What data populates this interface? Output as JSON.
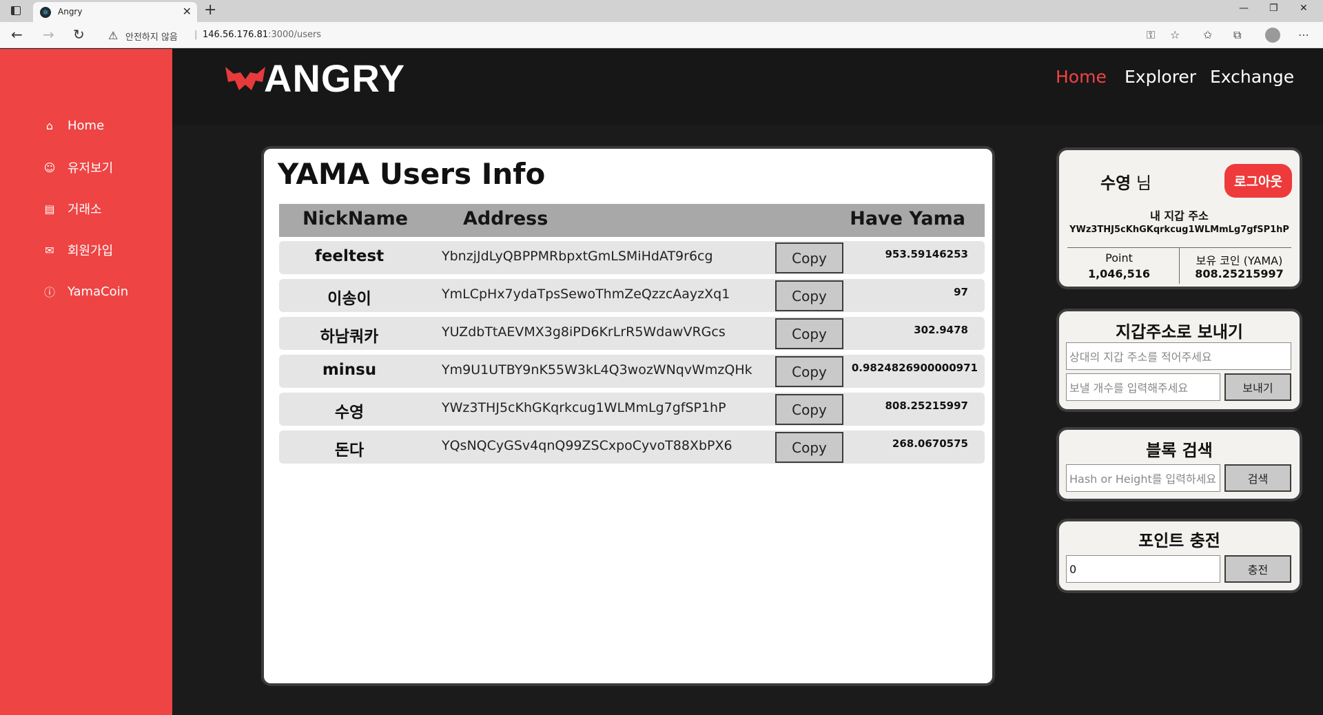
{
  "browser": {
    "tab_title": "Angry",
    "tab_close": "✕",
    "new_tab": "+",
    "security_label": "안전하지 않음",
    "url_host": "146.56.176.81",
    "url_path": ":3000/users",
    "minimize": "—",
    "maximize": "❐",
    "close": "✕"
  },
  "sidebar": {
    "items": [
      {
        "icon": "home-icon",
        "label": "Home"
      },
      {
        "icon": "user-icon",
        "label": "유저보기"
      },
      {
        "icon": "database-icon",
        "label": "거래소"
      },
      {
        "icon": "mail-icon",
        "label": "회원가입"
      },
      {
        "icon": "info-icon",
        "label": "YamaCoin"
      }
    ]
  },
  "header": {
    "logo_text": "ANGRY",
    "nav": [
      "Home",
      "Explorer",
      "Exchange"
    ],
    "active_nav": "Home"
  },
  "users_panel": {
    "title": "YAMA Users Info",
    "columns": [
      "NickName",
      "Address",
      "Have Yama"
    ],
    "copy_label": "Copy",
    "rows": [
      {
        "nick": "feeltest",
        "address": "YbnzjJdLyQBPPMRbpxtGmLSMiHdAT9r6cg",
        "yama": "953.59146253"
      },
      {
        "nick": "이송이",
        "address": "YmLCpHx7ydaTpsSewoThmZeQzzcAayzXq1",
        "yama": "97"
      },
      {
        "nick": "하남쿼카",
        "address": "YUZdbTtAEVMX3g8iPD6KrLrR5WdawVRGcs",
        "yama": "302.9478"
      },
      {
        "nick": "minsu",
        "address": "Ym9U1UTBY9nK55W3kL4Q3wozWNqvWmzQHk",
        "yama": "0.9824826900000971"
      },
      {
        "nick": "수영",
        "address": "YWz3THJ5cKhGKqrkcug1WLMmLg7gfSP1hP",
        "yama": "808.25215997"
      },
      {
        "nick": "돈다",
        "address": "YQsNQCyGSv4qnQ99ZSCxpoCyvoT88XbPX6",
        "yama": "268.0670575"
      }
    ]
  },
  "account": {
    "name": "수영",
    "honorific": "님",
    "logout_label": "로그아웃",
    "wallet_label": "내 지갑 주소",
    "wallet_address": "YWz3THJ5cKhGKqrkcug1WLMmLg7gfSP1hP",
    "point_label": "Point",
    "point_value": "1,046,516",
    "coin_label": "보유 코인 (YAMA)",
    "coin_value": "808.25215997"
  },
  "send": {
    "title": "지갑주소로 보내기",
    "address_placeholder": "상대의 지갑 주소를 적어주세요",
    "amount_placeholder": "보낼 개수를 입력해주세요",
    "button": "보내기"
  },
  "block_search": {
    "title": "블록 검색",
    "placeholder": "Hash or Height를 입력하세요",
    "button": "검색"
  },
  "charge": {
    "title": "포인트 충전",
    "value": "0",
    "button": "충전"
  },
  "colors": {
    "accent": "#ee4444",
    "header_bg": "#171717"
  }
}
